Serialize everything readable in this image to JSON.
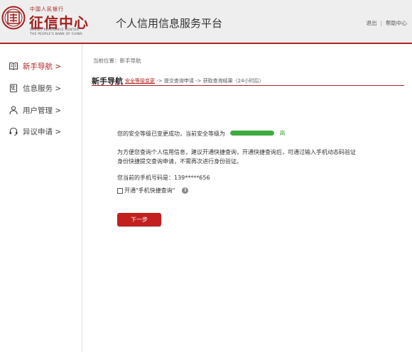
{
  "logo": {
    "top_text": "中国人民银行",
    "main_text": "征信中心",
    "en_line1": "CREDIT REFERENCE CENTER",
    "en_line2": "THE PEOPLE'S BANK OF CHINA"
  },
  "header": {
    "platform_title": "个人信用信息服务平台",
    "logout_label": "退出",
    "separator": "|",
    "help_label": "帮助中心"
  },
  "sidebar": {
    "items": [
      {
        "label": "新手导航 >",
        "icon": "book-icon",
        "active": true
      },
      {
        "label": "信息服务 >",
        "icon": "document-icon",
        "active": false
      },
      {
        "label": "用户管理 >",
        "icon": "user-icon",
        "active": false
      },
      {
        "label": "异议申请 >",
        "icon": "headset-icon",
        "active": false
      }
    ]
  },
  "main": {
    "breadcrumb": "当前位置：新手导航",
    "title": "新手导航",
    "steps": {
      "step1": "安全等级变更",
      "arrow1": " -> ",
      "step2": "提交查询申请",
      "arrow2": " -> ",
      "step3": "获取查询结果（24小时后）"
    },
    "security_text": "您的安全等级已变更成功，当前安全等级为",
    "security_level_label": "高",
    "security_level_fraction": 1.0,
    "advice_line1": "为方便您查询个人信用信息，建议开通快捷查询，开通快捷查询后，可通过输入手机动态码验证",
    "advice_line2": "身份快捷提交查询申请，不需再次进行身份验证。",
    "phone_text": "您当前的手机号码是：139*****656",
    "quick_query_label": "开通\"手机快捷查询\"",
    "info_icon_glyph": "i",
    "next_button": "下一步"
  },
  "colors": {
    "accent": "#b22222",
    "button": "#c21f1f",
    "level_green": "#3fab3f",
    "header_bg": "#eeeeee"
  }
}
